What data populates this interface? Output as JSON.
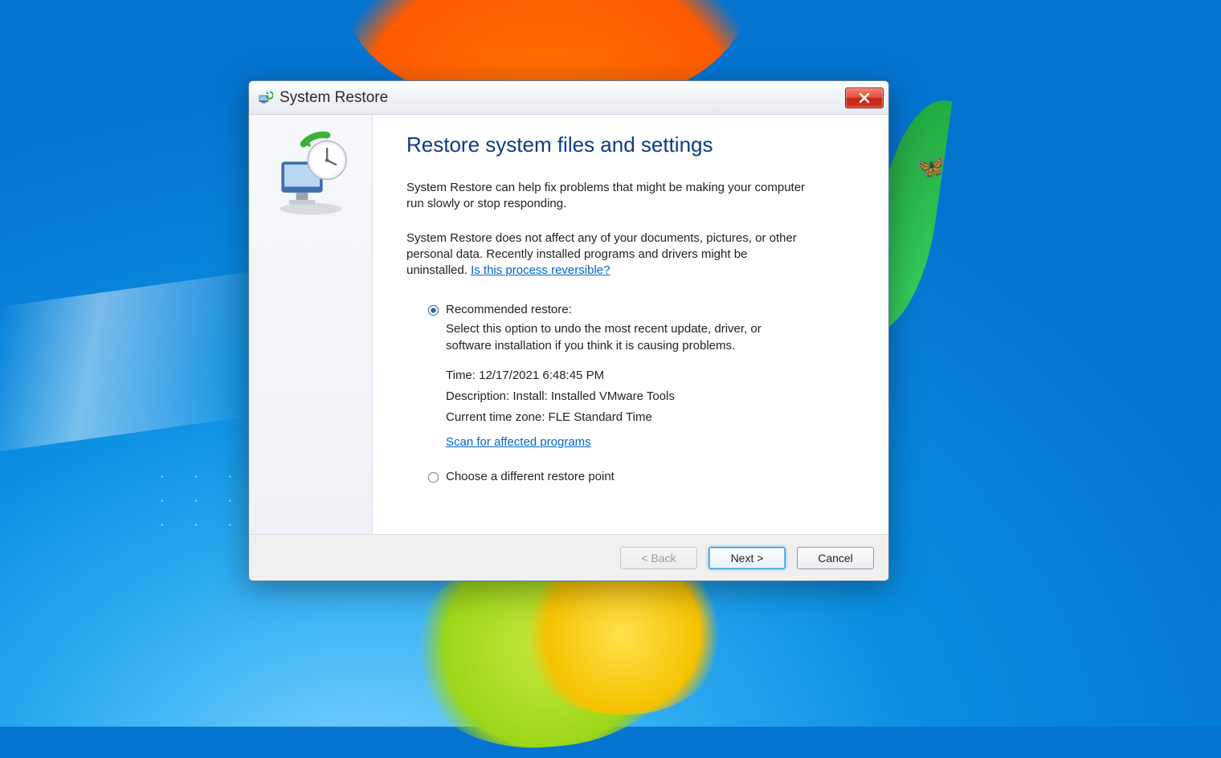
{
  "window": {
    "title": "System Restore"
  },
  "content": {
    "heading": "Restore system files and settings",
    "para1": "System Restore can help fix problems that might be making your computer run slowly or stop responding.",
    "para2_pre": "System Restore does not affect any of your documents, pictures, or other personal data. Recently installed programs and drivers might be uninstalled. ",
    "para2_link": "Is this process reversible?"
  },
  "options": {
    "recommended": {
      "label": "Recommended restore:",
      "desc": "Select this option to undo the most recent update, driver, or software installation if you think it is causing problems.",
      "time": "Time: 12/17/2021 6:48:45 PM",
      "description_line": "Description: Install: Installed VMware Tools",
      "timezone": "Current time zone: FLE Standard Time",
      "scan_link": "Scan for affected programs",
      "selected": true
    },
    "different": {
      "label": "Choose a different restore point",
      "selected": false
    }
  },
  "buttons": {
    "back": "< Back",
    "next": "Next >",
    "cancel": "Cancel"
  }
}
